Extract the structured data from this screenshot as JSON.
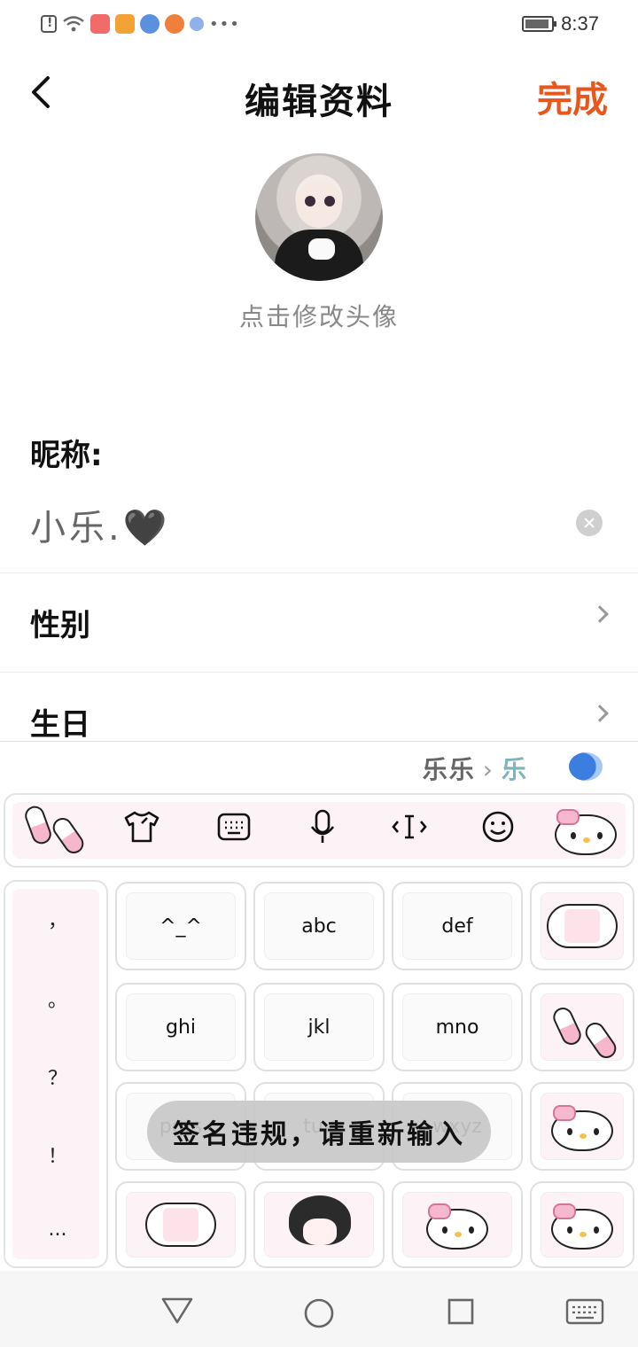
{
  "status_bar": {
    "time": "8:37",
    "icons": [
      "alert-icon",
      "wifi-icon",
      "app-icon-red",
      "app-icon-orange",
      "app-icon-baidu",
      "app-icon-orange-2",
      "app-icon-paw",
      "more-dots"
    ]
  },
  "header": {
    "title": "编辑资料",
    "done_label": "完成",
    "done_color": "#e8561c"
  },
  "avatar": {
    "change_label": "点击修改头像"
  },
  "form": {
    "nickname_label": "昵称:",
    "nickname_value": "小乐.🖤",
    "gender_label": "性别",
    "birthday_label": "生日"
  },
  "keyboard": {
    "candidate_pinyin": "乐乐",
    "candidate_arrow": "›",
    "candidate_pick": "乐",
    "toolbar": [
      "pill-sticker-icon",
      "skin-shirt-icon",
      "keyboard-icon",
      "microphone-icon",
      "cursor-move-icon",
      "emoji-icon",
      "hello-kitty-icon"
    ],
    "punctuation": [
      "，",
      "。",
      "？",
      "！",
      "..."
    ],
    "keys": {
      "emoticon": "^_^",
      "abc": "abc",
      "def": "def",
      "ghi": "ghi",
      "jkl": "jkl",
      "mno": "mno",
      "pqrs": "pqrs",
      "tuv": "tuv",
      "wxyz": "wxyz"
    }
  },
  "toast": {
    "message": "签名违规，请重新输入"
  }
}
